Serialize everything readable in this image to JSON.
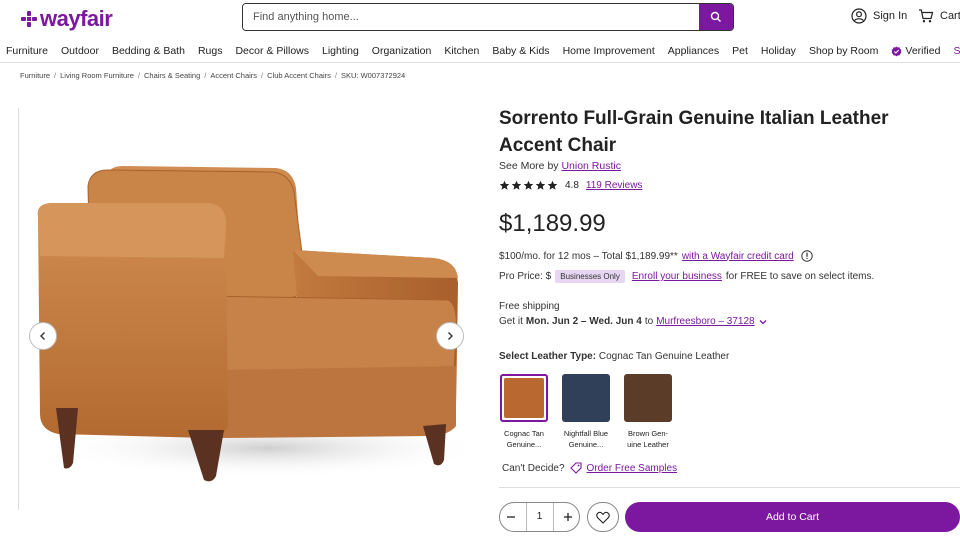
{
  "header": {
    "logo_text": "wayfair",
    "search_placeholder": "Find anything home...",
    "sign_in": "Sign In",
    "cart": "Cart"
  },
  "nav": {
    "items": [
      "Furniture",
      "Outdoor",
      "Bedding & Bath",
      "Rugs",
      "Decor & Pillows",
      "Lighting",
      "Organization",
      "Kitchen",
      "Baby & Kids",
      "Home Improvement",
      "Appliances",
      "Pet",
      "Holiday",
      "Shop by Room"
    ],
    "verified": "Verified",
    "overflow": "Se"
  },
  "breadcrumb": [
    "Furniture",
    "Living Room Furniture",
    "Chairs & Seating",
    "Accent Chairs",
    "Club Accent Chairs"
  ],
  "sku": "SKU: W007372924",
  "product": {
    "title": "Sorrento Full-Grain Genuine Italian Leather Accent Chair",
    "see_more_prefix": "See More by",
    "brand": "Union Rustic",
    "rating": "4.8",
    "stars": 5,
    "reviews": "119 Reviews",
    "price": "$1,189.99",
    "credit_text": "$100/mo. for 12 mos – Total $1,189.99**",
    "credit_link": "with a Wayfair credit card",
    "pro_price_label": "Pro Price: $",
    "biz_badge": "Businesses Only",
    "enroll_link": "Enroll your business",
    "enroll_suffix": "for FREE to save on select items.",
    "free_shipping": "Free shipping",
    "get_it_prefix": "Get it",
    "delivery_dates": "Mon. Jun 2 – Wed. Jun 4",
    "to_word": "to",
    "location": "Murfreesboro – 37128",
    "select_label": "Select Leather Type:",
    "select_value": "Cognac Tan Genuine Leather",
    "swatches": [
      {
        "label1": "Cognac Tan",
        "label2": "Genuine...",
        "color": "#b9682f",
        "selected": true
      },
      {
        "label1": "Nightfall Blue",
        "label2": "Genuine...",
        "color": "#2f4058",
        "selected": false
      },
      {
        "label1": "Brown Gen-",
        "label2": "uine Leather",
        "color": "#5a3c28",
        "selected": false
      }
    ],
    "cant_decide": "Can't Decide?",
    "order_samples": "Order Free Samples",
    "quantity": "1",
    "add_to_cart": "Add to Cart"
  },
  "colors": {
    "brand": "#7b189f",
    "chair": "#c98548"
  }
}
